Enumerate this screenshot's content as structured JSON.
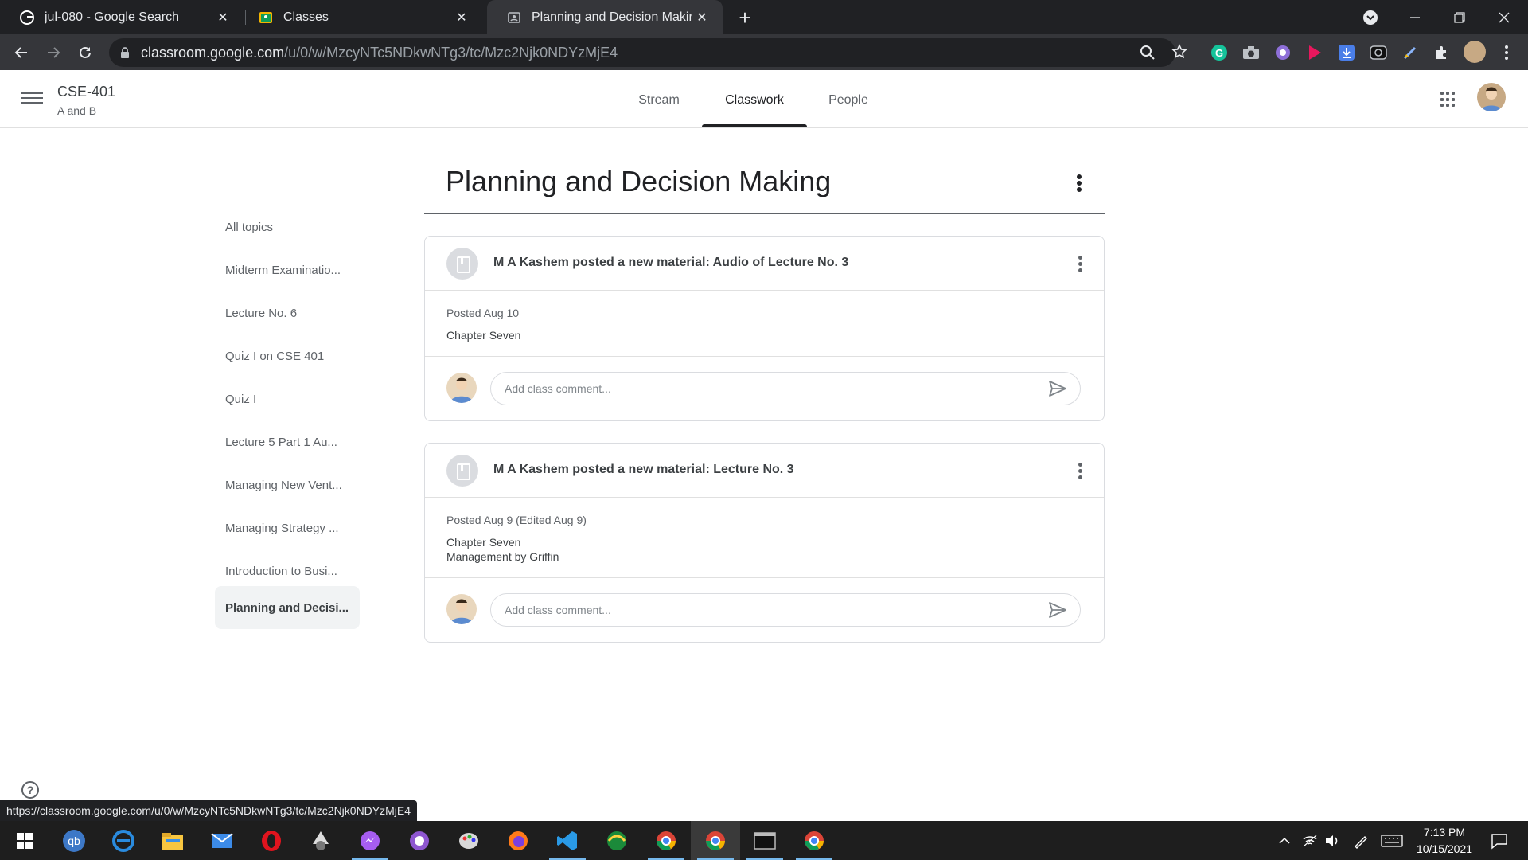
{
  "browser": {
    "tabs": [
      {
        "title": "jul-080 - Google Search"
      },
      {
        "title": "Classes"
      },
      {
        "title": "Planning and Decision Making"
      }
    ],
    "url_host": "classroom.google.com",
    "url_path": "/u/0/w/MzcyNTc5NDkwNTg3/tc/Mzc2Njk0NDYzMjE4",
    "status_url": "https://classroom.google.com/u/0/w/MzcyNTc5NDkwNTg3/tc/Mzc2Njk0NDYzMjE4"
  },
  "header": {
    "course_name": "CSE-401",
    "section": "A and B",
    "nav": [
      "Stream",
      "Classwork",
      "People"
    ],
    "active_nav": "Classwork"
  },
  "sidebar": {
    "topics": [
      "All topics",
      "Midterm Examinatio...",
      "Lecture No. 6",
      "Quiz I on CSE 401",
      "Quiz I",
      "Lecture 5 Part 1 Au...",
      "Managing New Vent...",
      "Managing Strategy ...",
      "Introduction to Busi...",
      "Planning and Decisi..."
    ],
    "active_topic": "Planning and Decisi..."
  },
  "main": {
    "topic_title": "Planning and Decision Making",
    "posts": [
      {
        "title": "M A Kashem posted a new material: Audio of Lecture No. 3",
        "posted": "Posted Aug 10",
        "lines": [
          "Chapter Seven"
        ],
        "comment_placeholder": "Add class comment..."
      },
      {
        "title": "M A Kashem posted a new material: Lecture No. 3",
        "posted": "Posted Aug 9 (Edited Aug 9)",
        "lines": [
          "Chapter Seven",
          "Management by Griffin"
        ],
        "comment_placeholder": "Add class comment..."
      }
    ]
  },
  "help": "?",
  "taskbar": {
    "time": "7:13 PM",
    "date": "10/15/2021"
  },
  "colors": {
    "chrome_dark": "#202124",
    "chrome_toolbar": "#35363a",
    "text_primary": "#202124",
    "text_secondary": "#5f6368",
    "border": "#dadce0",
    "taskbar": "#1e1e1e",
    "taskbar_accent": "#76b9ed"
  }
}
